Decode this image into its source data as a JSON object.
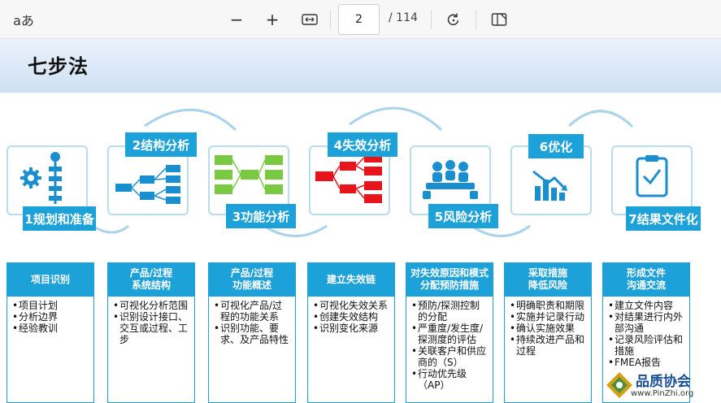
{
  "toolbar": {
    "page_number": "2",
    "page_total": "/ 114",
    "read_aloud_icon": "aあ",
    "zoom_out_icon": "−",
    "zoom_in_icon": "+"
  },
  "slide": {
    "title": "七步法",
    "steps": [
      {
        "label": "1规划和准备"
      },
      {
        "label": "2结构分析"
      },
      {
        "label": "3功能分析"
      },
      {
        "label": "4失效分析"
      },
      {
        "label": "5风险分析"
      },
      {
        "label": "6优化"
      },
      {
        "label": "7结果文件化"
      }
    ],
    "columns": [
      {
        "head": "项目识别",
        "items": [
          "项目计划",
          "分析边界",
          "经验教训"
        ]
      },
      {
        "head": "产品/过程\n系统结构",
        "items": [
          "可视化分析范围",
          "识别设计接口、交互或过程、工步"
        ]
      },
      {
        "head": "产品/过程\n功能概述",
        "items": [
          "可视化产品/过程的功能关系",
          "识别功能、要求、及产品特性"
        ]
      },
      {
        "head": "建立失效链",
        "items": [
          "可视化失效关系",
          "创建失效结构",
          "识别变化来源"
        ]
      },
      {
        "head": "对失效原因和模式分配预防措施",
        "items": [
          "预防/探测控制的分配",
          "严重度/发生度/探测度的评估",
          "关联客户和供应商的（S）",
          "行动优先级（AP）"
        ]
      },
      {
        "head": "采取措施\n降低风险",
        "items": [
          "明确职责和期限",
          "实施并记录行动",
          "确认实施效果",
          "持续改进产品和过程"
        ]
      },
      {
        "head": "形成文件\n沟通交流",
        "items": [
          "建立文件内容",
          "对结果进行内外部沟通",
          "记录风险评估和措施",
          "FMEA报告"
        ]
      }
    ],
    "watermark": {
      "name": "品质协会",
      "url": "www.PinZhi.org"
    }
  },
  "colors": {
    "accent": "#1da1d9",
    "card_border": "#b9dcf0",
    "green": "#7ac943",
    "red": "#e8141c"
  }
}
